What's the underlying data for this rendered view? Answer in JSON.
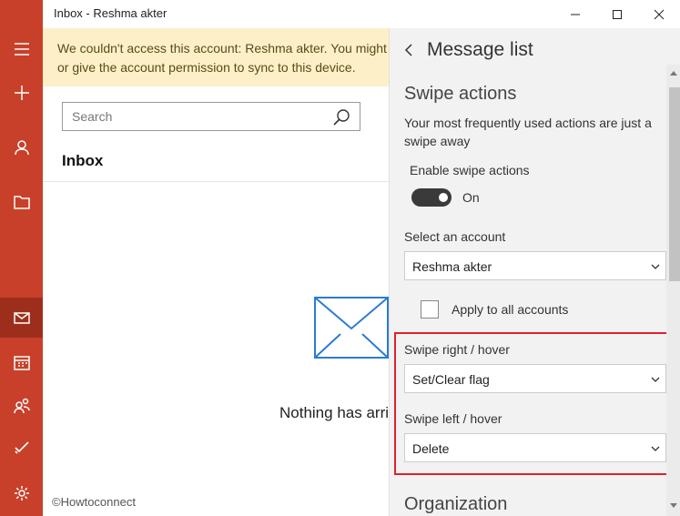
{
  "window": {
    "title": "Inbox - Reshma akter"
  },
  "banner": {
    "line1": "We couldn't access this account: Reshma akter. You might",
    "line2": "or give the account permission to sync to this device."
  },
  "search": {
    "placeholder": "Search"
  },
  "inbox": {
    "title": "Inbox",
    "empty_message": "Nothing has arrived"
  },
  "watermark": "©Howtoconnect",
  "settings": {
    "panel_title": "Message list",
    "swipe": {
      "section_title": "Swipe actions",
      "description": "Your most frequently used actions are just a swipe away",
      "enable_label": "Enable swipe actions",
      "toggle_state": "On",
      "account_label": "Select an account",
      "account_value": "Reshma akter",
      "apply_all_label": "Apply to all accounts",
      "swipe_right_label": "Swipe right / hover",
      "swipe_right_value": "Set/Clear flag",
      "swipe_left_label": "Swipe left / hover",
      "swipe_left_value": "Delete"
    },
    "organization_title": "Organization"
  },
  "colors": {
    "rail": "#c8402a",
    "rail_active": "#9e2e1c",
    "banner": "#fdf0c8",
    "flyout": "#f2f2f2",
    "highlight": "#e0202a"
  }
}
